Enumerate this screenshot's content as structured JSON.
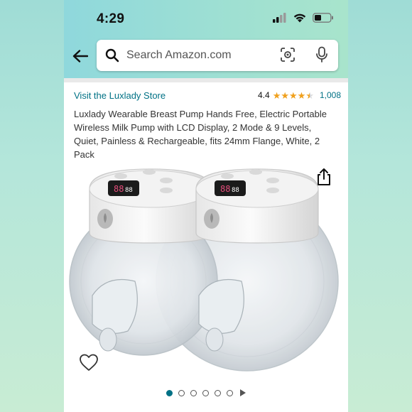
{
  "status": {
    "time": "4:29"
  },
  "search": {
    "placeholder": "Search Amazon.com"
  },
  "store": {
    "link": "Visit the Luxlady Store"
  },
  "rating": {
    "value": "4.4",
    "stars": 4.4,
    "count": "1,008"
  },
  "product": {
    "title": "Luxlady Wearable Breast Pump Hands Free, Electric Portable Wireless Milk Pump with LCD Display, 2 Mode & 9 Levels, Quiet, Painless & Rechargeable, fits 24mm Flange, White, 2 Pack"
  },
  "icons": {
    "back": "arrow-left-icon",
    "search": "magnifier-icon",
    "camera": "camera-scan-icon",
    "mic": "microphone-icon",
    "share": "share-icon",
    "favorite": "heart-icon"
  },
  "carousel": {
    "total_images": 6,
    "active_index": 1
  },
  "colors": {
    "link": "#007185",
    "star": "#f0a01c",
    "header": "#9fe0d2"
  }
}
